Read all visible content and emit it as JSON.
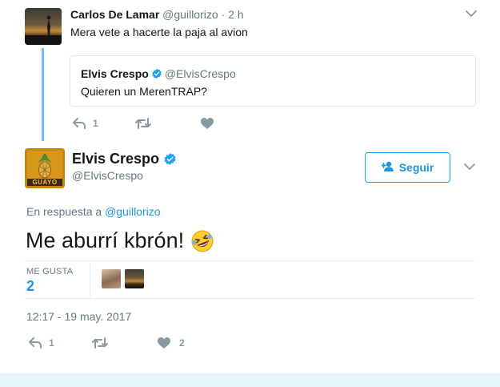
{
  "parent_tweet": {
    "author_name": "Carlos De Lamar",
    "author_handle": "@guillorizo · 2 h",
    "text": "Mera vete a hacerte la paja al avion",
    "reply_count": "1"
  },
  "quoted_tweet": {
    "author_name": "Elvis Crespo",
    "author_handle": "@ElvisCrespo",
    "text": "Quieren un MerenTRAP?"
  },
  "main_tweet": {
    "author_name": "Elvis Crespo",
    "author_handle": "@ElvisCrespo",
    "avatar_label": "GUAYO",
    "follow_label": "Seguir",
    "reply_prefix": "En respuesta a ",
    "reply_to": "@guillorizo",
    "text": "Me aburrí kbrón!",
    "likes_label": "ME GUSTA",
    "likes_count": "2",
    "timestamp": "12:17 - 19 may. 2017",
    "reply_count": "1",
    "like_action_count": "2"
  },
  "icons": {
    "verified": "verified-badge-icon",
    "chevron": "chevron-down-icon",
    "reply": "reply-icon",
    "retweet": "retweet-icon",
    "like": "heart-icon",
    "follow": "add-user-icon",
    "emoji": "rofl-emoji-icon"
  },
  "colors": {
    "accent": "#1da1f2",
    "link": "#1b95e0",
    "muted": "#657786",
    "thread_line": "#6fc0ee",
    "icon_gray": "#8899a6"
  }
}
